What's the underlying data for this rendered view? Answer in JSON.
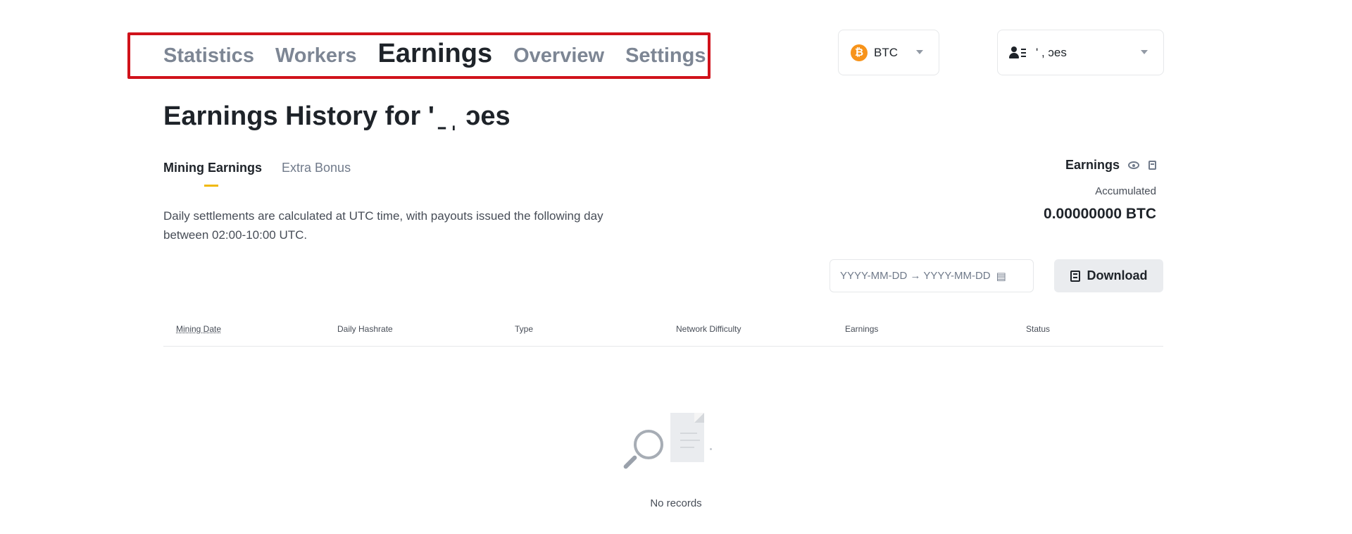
{
  "nav": {
    "tabs": [
      {
        "label": "Statistics",
        "active": false
      },
      {
        "label": "Workers",
        "active": false
      },
      {
        "label": "Earnings",
        "active": true
      },
      {
        "label": "Overview",
        "active": false
      },
      {
        "label": "Settings",
        "active": false
      }
    ]
  },
  "coin_select": {
    "icon": "bitcoin-icon",
    "icon_glyph": "₿",
    "value": "BTC",
    "accent": "#f7931a"
  },
  "account_select": {
    "icon": "account-icon",
    "value": "'  ,  ɔes"
  },
  "page_title": "Earnings History for '  ̱  ˌ  ɔes",
  "subtabs": [
    {
      "label": "Mining Earnings",
      "active": true
    },
    {
      "label": "Extra Bonus",
      "active": false
    }
  ],
  "description": "Daily settlements are calculated at UTC time, with payouts issued the following day between 02:00-10:00 UTC.",
  "earnings_panel": {
    "title": "Earnings",
    "accumulated_label": "Accumulated",
    "accumulated_value": "0.00000000 BTC"
  },
  "date_range": {
    "placeholder": "YYYY-MM-DD → YYYY-MM-DD",
    "icon": "calendar-icon"
  },
  "download_button": {
    "label": "Download",
    "icon": "download-icon"
  },
  "table": {
    "columns": [
      "Mining Date",
      "Daily Hashrate",
      "Type",
      "Network Difficulty",
      "Earnings",
      "Status"
    ],
    "rows": []
  },
  "empty_state": {
    "icon": "no-records-icon",
    "text": "No records"
  },
  "colors": {
    "accent": "#f0b90b",
    "highlight_box": "#d0121b",
    "text_primary": "#1e2329",
    "text_secondary": "#707a8a"
  }
}
